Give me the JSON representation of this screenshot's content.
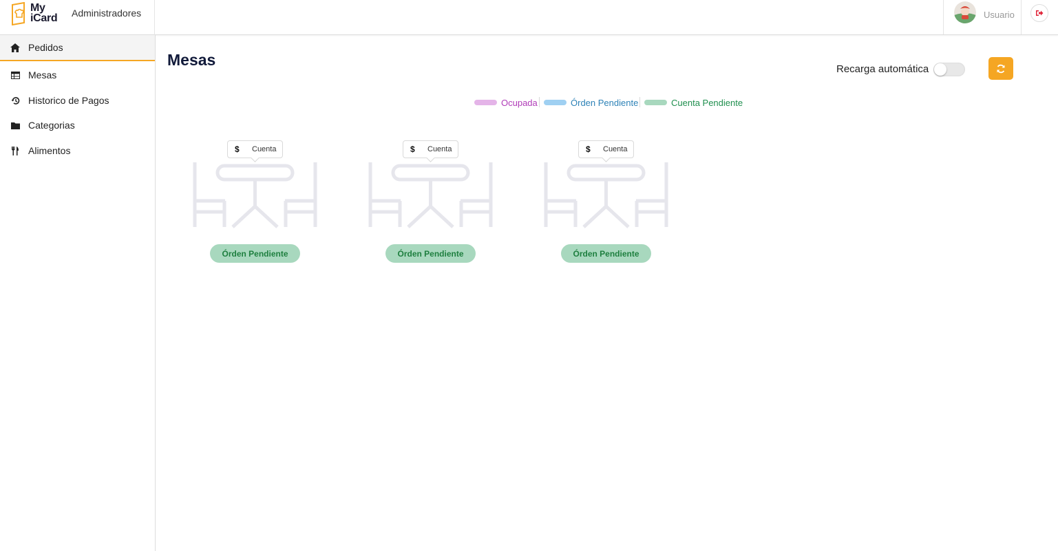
{
  "brand": {
    "logo_line1": "My",
    "logo_line2": "iCard",
    "subtitle": "Administradores",
    "accent_color": "#f5a623"
  },
  "user": {
    "name": "Usuario"
  },
  "sidebar": {
    "items": [
      {
        "label": "Pedidos",
        "icon": "home-icon",
        "active": true
      },
      {
        "label": "Mesas",
        "icon": "table-icon",
        "active": false
      },
      {
        "label": "Historico de Pagos",
        "icon": "history-icon",
        "active": false
      },
      {
        "label": "Categorias",
        "icon": "folder-icon",
        "active": false
      },
      {
        "label": "Alimentos",
        "icon": "utensils-icon",
        "active": false
      }
    ]
  },
  "main": {
    "title": "Mesas",
    "auto_reload_label": "Recarga automática",
    "auto_reload_on": false
  },
  "legend": [
    {
      "label": "Ocupada",
      "color": "#e4b4e8",
      "text_color": "#b03cb8"
    },
    {
      "label": "Órden Pendiente",
      "color": "#9fd0f2",
      "text_color": "#2d82b7"
    },
    {
      "label": "Cuenta Pendiente",
      "color": "#a8d8be",
      "text_color": "#1f8f4e"
    }
  ],
  "tables": [
    {
      "cuenta_label": "Cuenta",
      "currency_symbol": "$",
      "status": "Órden Pendiente"
    },
    {
      "cuenta_label": "Cuenta",
      "currency_symbol": "$",
      "status": "Órden Pendiente"
    },
    {
      "cuenta_label": "Cuenta",
      "currency_symbol": "$",
      "status": "Órden Pendiente"
    }
  ]
}
